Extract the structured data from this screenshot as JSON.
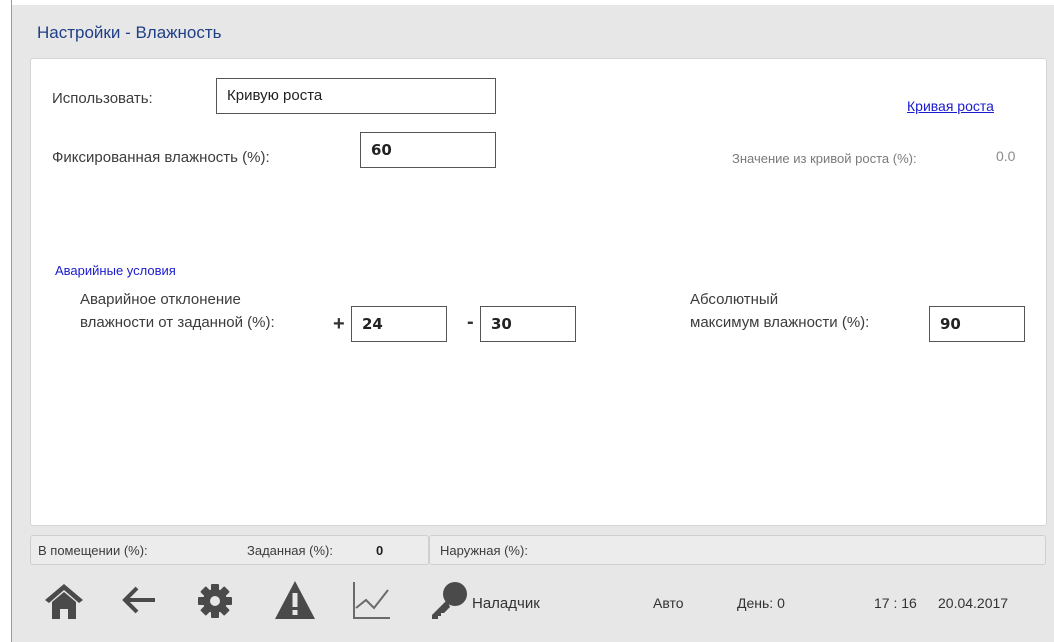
{
  "header": {
    "title": "Настройки - Влажность"
  },
  "settings": {
    "use_label": "Использовать:",
    "use_value": "Кривую роста",
    "growth_curve_link": "Кривая роста",
    "fixed_humidity_label": "Фиксированная влажность (%):",
    "fixed_humidity_value": "60",
    "curve_value_label": "Значение из кривой роста (%):",
    "curve_value": "0.0"
  },
  "alarm": {
    "section_title": "Аварийные условия",
    "deviation_label_line1": "Аварийное отклонение",
    "deviation_label_line2": "влажности от заданной (%):",
    "plus_sign": "+",
    "plus_value": "24",
    "minus_sign": "-",
    "minus_value": "30",
    "abs_max_label_line1": "Абсолютный",
    "abs_max_label_line2": "максимум влажности (%):",
    "abs_max_value": "90"
  },
  "status": {
    "indoor_label": "В помещении (%):",
    "target_label": "Заданная (%):",
    "target_value": "0",
    "outdoor_label": "Наружная (%):"
  },
  "nav": {
    "user_label": "Наладчик",
    "mode": "Авто",
    "day": "День: 0",
    "time": "17 : 16",
    "date": "20.04.2017",
    "icons": [
      "home-icon",
      "back-arrow-icon",
      "gear-icon",
      "warning-icon",
      "chart-icon",
      "key-icon"
    ]
  }
}
